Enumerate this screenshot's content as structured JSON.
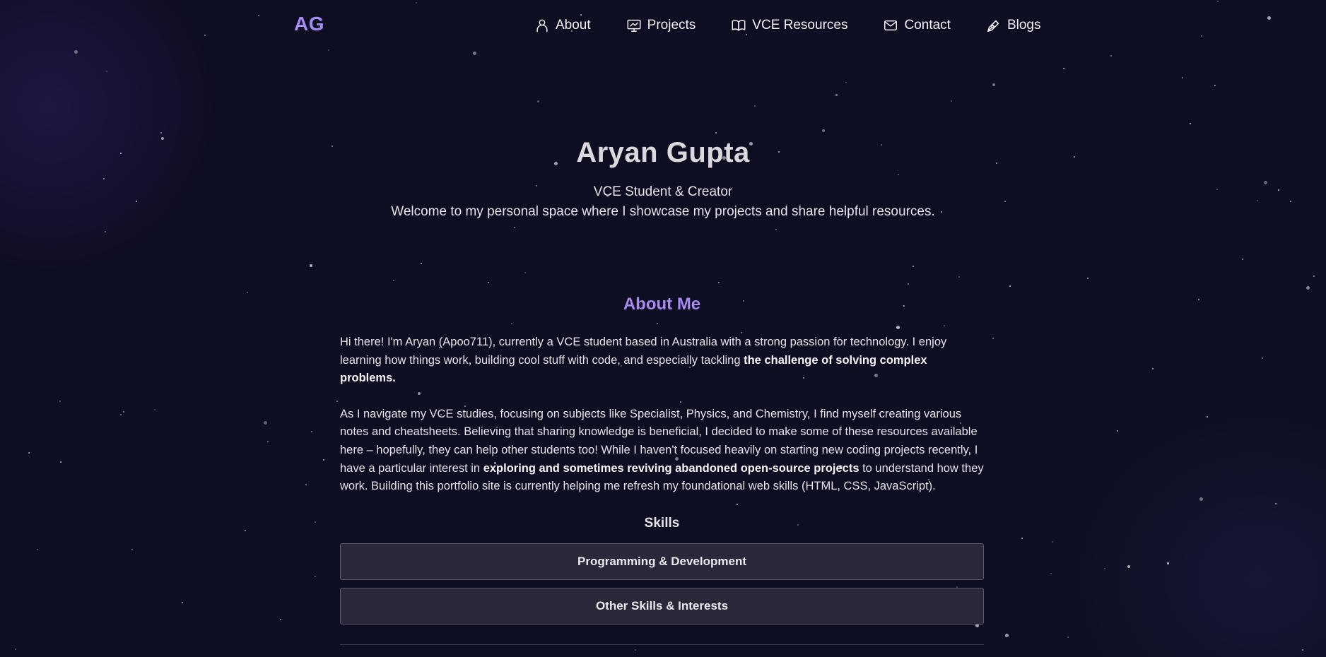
{
  "header": {
    "logo": "AG",
    "nav": [
      {
        "label": "About",
        "icon": "user-icon"
      },
      {
        "label": "Projects",
        "icon": "presentation-icon"
      },
      {
        "label": "VCE Resources",
        "icon": "book-icon"
      },
      {
        "label": "Contact",
        "icon": "envelope-icon"
      },
      {
        "label": "Blogs",
        "icon": "pen-nib-icon"
      }
    ]
  },
  "hero": {
    "name": "Aryan Gupta",
    "tagline": "VCE Student & Creator",
    "welcome": "Welcome to my personal space where I showcase my projects and share helpful resources."
  },
  "about": {
    "title": "About Me",
    "p1": {
      "text": "Hi there! I'm Aryan (Apoo711), currently a VCE student based in Australia with a strong passion for technology. I enjoy learning how things work, building cool stuff with code, and especially tackling ",
      "bold": "the challenge of solving complex problems."
    },
    "p2": {
      "text_before": "As I navigate my VCE studies, focusing on subjects like Specialist, Physics, and Chemistry, I find myself creating various notes and cheatsheets. Believing that sharing knowledge is beneficial, I decided to make some of these resources available here – hopefully, they can help other students too! While I haven't focused heavily on starting new coding projects recently, I have a particular interest in ",
      "bold": "exploring and sometimes reviving abandoned open-source projects",
      "text_after": " to understand how they work. Building this portfolio site is currently helping me refresh my foundational web skills (HTML, CSS, JavaScript)."
    },
    "skills_title": "Skills",
    "skills": [
      {
        "label": "Programming & Development"
      },
      {
        "label": "Other Skills & Interests"
      }
    ]
  },
  "colors": {
    "background": "#0e0e22",
    "accent": "#a58bf2",
    "text": "#e4e4ea",
    "button_bg": "#2a2838"
  }
}
